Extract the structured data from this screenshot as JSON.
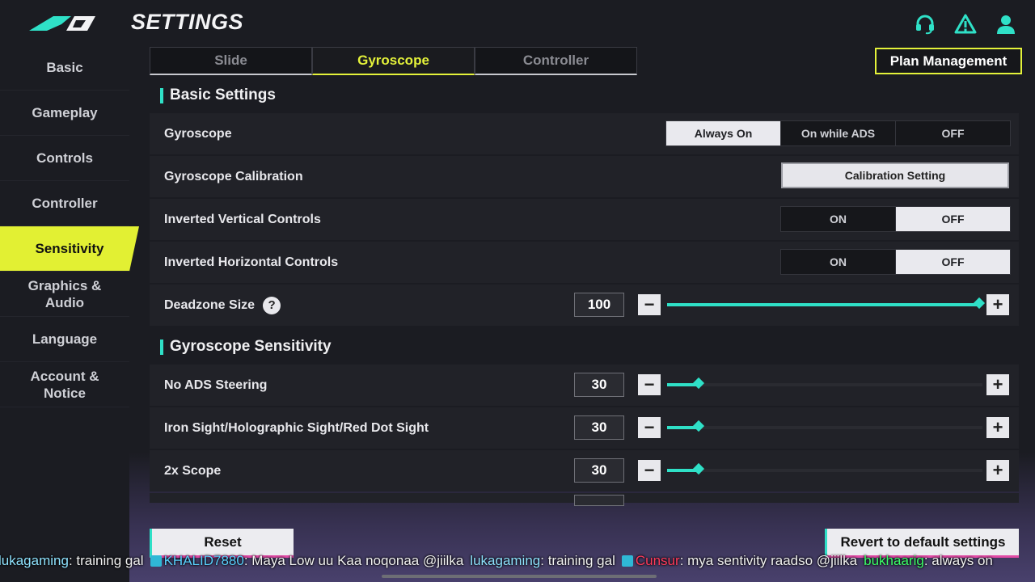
{
  "header": {
    "title": "SETTINGS",
    "icons": [
      "headset-icon",
      "warning-icon",
      "profile-icon"
    ]
  },
  "sidebar": {
    "items": [
      {
        "label": "Basic"
      },
      {
        "label": "Gameplay"
      },
      {
        "label": "Controls"
      },
      {
        "label": "Controller"
      },
      {
        "label": "Sensitivity",
        "active": true
      },
      {
        "label": "Graphics &\nAudio"
      },
      {
        "label": "Language"
      },
      {
        "label": "Account &\nNotice"
      }
    ]
  },
  "tabs": [
    {
      "label": "Slide"
    },
    {
      "label": "Gyroscope",
      "active": true
    },
    {
      "label": "Controller"
    }
  ],
  "plan_management_label": "Plan Management",
  "basic_settings": {
    "heading": "Basic Settings",
    "gyroscope": {
      "label": "Gyroscope",
      "options": [
        "Always On",
        "On while ADS",
        "OFF"
      ],
      "selected": "Always On"
    },
    "calibration": {
      "label": "Gyroscope Calibration",
      "button": "Calibration Setting"
    },
    "inverted_vertical": {
      "label": "Inverted Vertical Controls",
      "options": [
        "ON",
        "OFF"
      ],
      "selected": "OFF"
    },
    "inverted_horizontal": {
      "label": "Inverted Horizontal Controls",
      "options": [
        "ON",
        "OFF"
      ],
      "selected": "OFF"
    },
    "deadzone": {
      "label": "Deadzone Size",
      "help": "?",
      "value": "100",
      "fraction": 0.99
    }
  },
  "gyro_sensitivity": {
    "heading": "Gyroscope Sensitivity",
    "rows": [
      {
        "label": "No ADS Steering",
        "value": "30",
        "fraction": 0.1
      },
      {
        "label": "Iron Sight/Holographic Sight/Red Dot Sight",
        "value": "30",
        "fraction": 0.1
      },
      {
        "label": "2x Scope",
        "value": "30",
        "fraction": 0.1
      }
    ]
  },
  "footer": {
    "reset_label": "Reset",
    "revert_label": "Revert to default settings"
  },
  "chat": [
    {
      "user": "lukagaming",
      "user_color": "#8fe3ff",
      "text": "training gal",
      "badge": false
    },
    {
      "user": "KHALID7880",
      "user_color": "#5ad1ff",
      "text": "Maya Low uu Kaa noqonaa @jiilka",
      "badge": true
    },
    {
      "user": "lukagaming",
      "user_color": "#8fe3ff",
      "text": "training gal",
      "badge": false
    },
    {
      "user": "Cunsur",
      "user_color": "#ff3b5c",
      "text": "mya sentivity raadso @jiilka",
      "badge": true
    },
    {
      "user": "bukhaarig",
      "user_color": "#3dff6a",
      "text": "always on",
      "badge": false
    }
  ],
  "colors": {
    "accent_yellow": "#e4f23a",
    "accent_teal": "#2fe0c7",
    "accent_pink": "#e14ba6"
  }
}
